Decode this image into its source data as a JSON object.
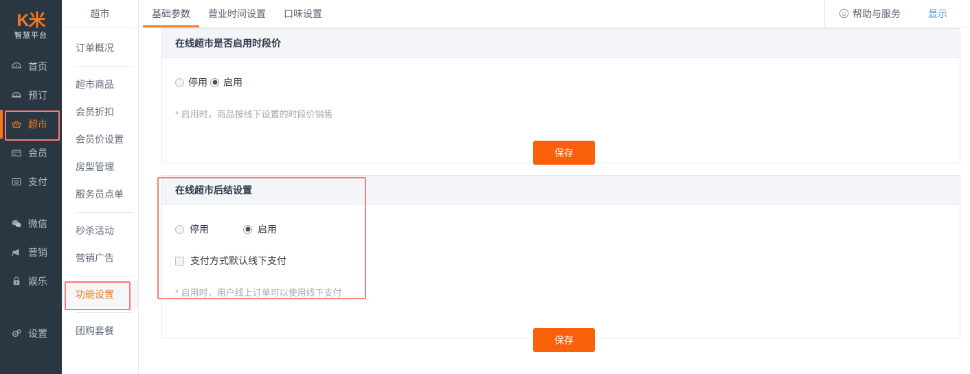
{
  "brand": {
    "logo_mark": "K米",
    "logo_sub": "智慧平台",
    "accent_color": "#f4761d",
    "highlight_color": "#f97b79",
    "save_color": "#fa5f0a"
  },
  "rail": {
    "items": [
      {
        "label": "首页",
        "icon": "dashboard-icon",
        "active": false
      },
      {
        "label": "预订",
        "icon": "booking-icon",
        "active": false
      },
      {
        "label": "超市",
        "icon": "basket-icon",
        "active": true
      },
      {
        "label": "会员",
        "icon": "card-icon",
        "active": false
      },
      {
        "label": "支付",
        "icon": "payment-icon",
        "active": false
      },
      {
        "label": "微信",
        "icon": "wechat-icon",
        "active": false
      },
      {
        "label": "营销",
        "icon": "megaphone-icon",
        "active": false
      },
      {
        "label": "娱乐",
        "icon": "entertainment-icon",
        "active": false
      },
      {
        "label": "设置",
        "icon": "gear-icon",
        "active": false
      }
    ]
  },
  "submenu": {
    "title": "超市",
    "items": [
      {
        "label": "订单概况",
        "active": false
      },
      {
        "label": "超市商品",
        "active": false
      },
      {
        "label": "会员折扣",
        "active": false
      },
      {
        "label": "会员价设置",
        "active": false
      },
      {
        "label": "房型管理",
        "active": false
      },
      {
        "label": "服务员点单",
        "active": false
      },
      {
        "label": "秒杀活动",
        "active": false
      },
      {
        "label": "营销广告",
        "active": false
      },
      {
        "label": "功能设置",
        "active": true
      },
      {
        "label": "团购套餐",
        "active": false
      }
    ]
  },
  "header": {
    "tabs": [
      {
        "label": "基础参数",
        "active": true
      },
      {
        "label": "营业时间设置",
        "active": false
      },
      {
        "label": "口味设置",
        "active": false
      }
    ],
    "help_label": "帮助与服务",
    "help_icon": "smiley-icon",
    "show_label": "显示"
  },
  "panels": [
    {
      "id": "time-price",
      "title": "在线超市是否启用时段价",
      "radios": [
        {
          "label": "停用",
          "checked": false
        },
        {
          "label": "启用",
          "checked": true
        }
      ],
      "hint": "* 启用时，商品按线下设置的时段价销售",
      "save_label": "保存"
    },
    {
      "id": "post-settle",
      "title": "在线超市后结设置",
      "radios": [
        {
          "label": "停用",
          "checked": false
        },
        {
          "label": "启用",
          "checked": true
        }
      ],
      "checkbox": {
        "label": "支付方式默认线下支付",
        "checked": false
      },
      "hint": "* 启用时，用户线上订单可以使用线下支付",
      "save_label": "保存"
    }
  ]
}
